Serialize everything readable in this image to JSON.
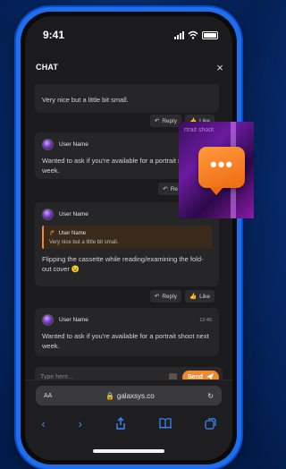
{
  "status": {
    "time": "9:41"
  },
  "chat": {
    "title": "CHAT",
    "close_icon": "×",
    "messages": [
      {
        "user": "",
        "time": "",
        "text": "Very nice but a little bit small.",
        "reply_label": "Reply",
        "like_label": "Like"
      },
      {
        "user": "User Name",
        "time": "",
        "text": "Wanted to ask if you're available for a portrait shoot next week.",
        "reply_label": "Re",
        "like_label": ""
      },
      {
        "user": "User Name",
        "time": "",
        "quote": {
          "user": "User Name",
          "text": "Very nice but a little bit small."
        },
        "text": "Flipping the cassette while reading/examining the fold-out cover 😉",
        "reply_label": "Reply",
        "like_label": "Like"
      },
      {
        "user": "User Name",
        "time": "12:45",
        "text": "Wanted to ask if you're available for a portrait shoot next week."
      }
    ]
  },
  "input": {
    "placeholder": "Type here...",
    "send_label": "Send"
  },
  "browser": {
    "text_size": "AA",
    "host": "galaxsys.co"
  },
  "overlay": {
    "neon_text": "rtrait shoot",
    "bubble": "•••"
  },
  "colors": {
    "accent": "#f08a30",
    "frame": "#1f6ef0",
    "link": "#3b8bff"
  }
}
